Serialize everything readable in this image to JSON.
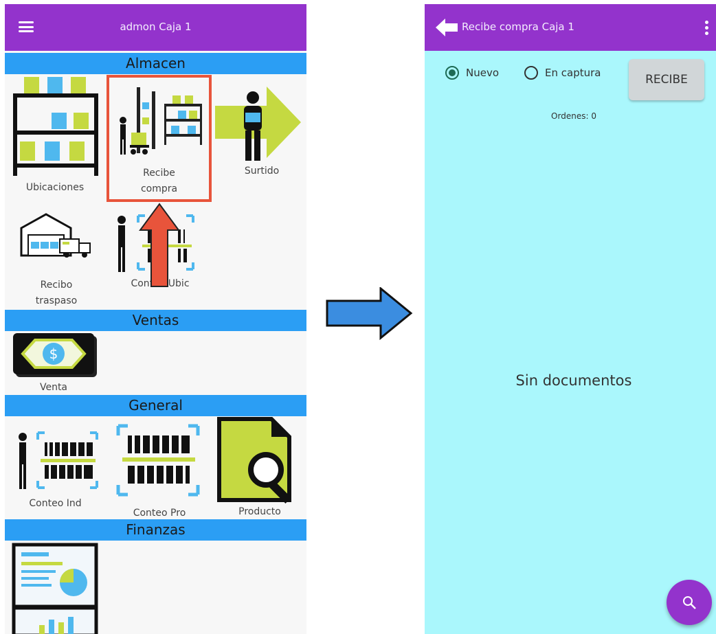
{
  "left_screen": {
    "title": "admon Caja 1",
    "sections": {
      "almacen": "Almacen",
      "ventas": "Ventas",
      "general": "General",
      "finanzas": "Finanzas"
    },
    "tiles": {
      "ubicaciones": "Ubicaciones",
      "recibe_compra_line1": "Recibe",
      "recibe_compra_line2": "compra",
      "surtido": "Surtido",
      "recibo_traspaso_line1": "Recibo",
      "recibo_traspaso_line2": "traspaso",
      "conteo_ubic": "Conteo Ubic",
      "venta": "Venta",
      "conteo_ind": "Conteo Ind",
      "conteo_pro": "Conteo Pro",
      "producto": "Producto"
    }
  },
  "right_screen": {
    "title": "Recibe compra Caja 1",
    "radio_nuevo": "Nuevo",
    "radio_en_captura": "En captura",
    "selected": "Nuevo",
    "recibe_button": "RECIBE",
    "ordenes": "Ordenes: 0",
    "empty_message": "Sin documentos"
  },
  "colors": {
    "app_bar": "#9333cc",
    "section_band": "#2b9ef4",
    "right_background": "#aaf7fc",
    "highlight_box": "#e8543b",
    "lime": "#c5d941",
    "flow_arrow": "#3b8de0"
  }
}
